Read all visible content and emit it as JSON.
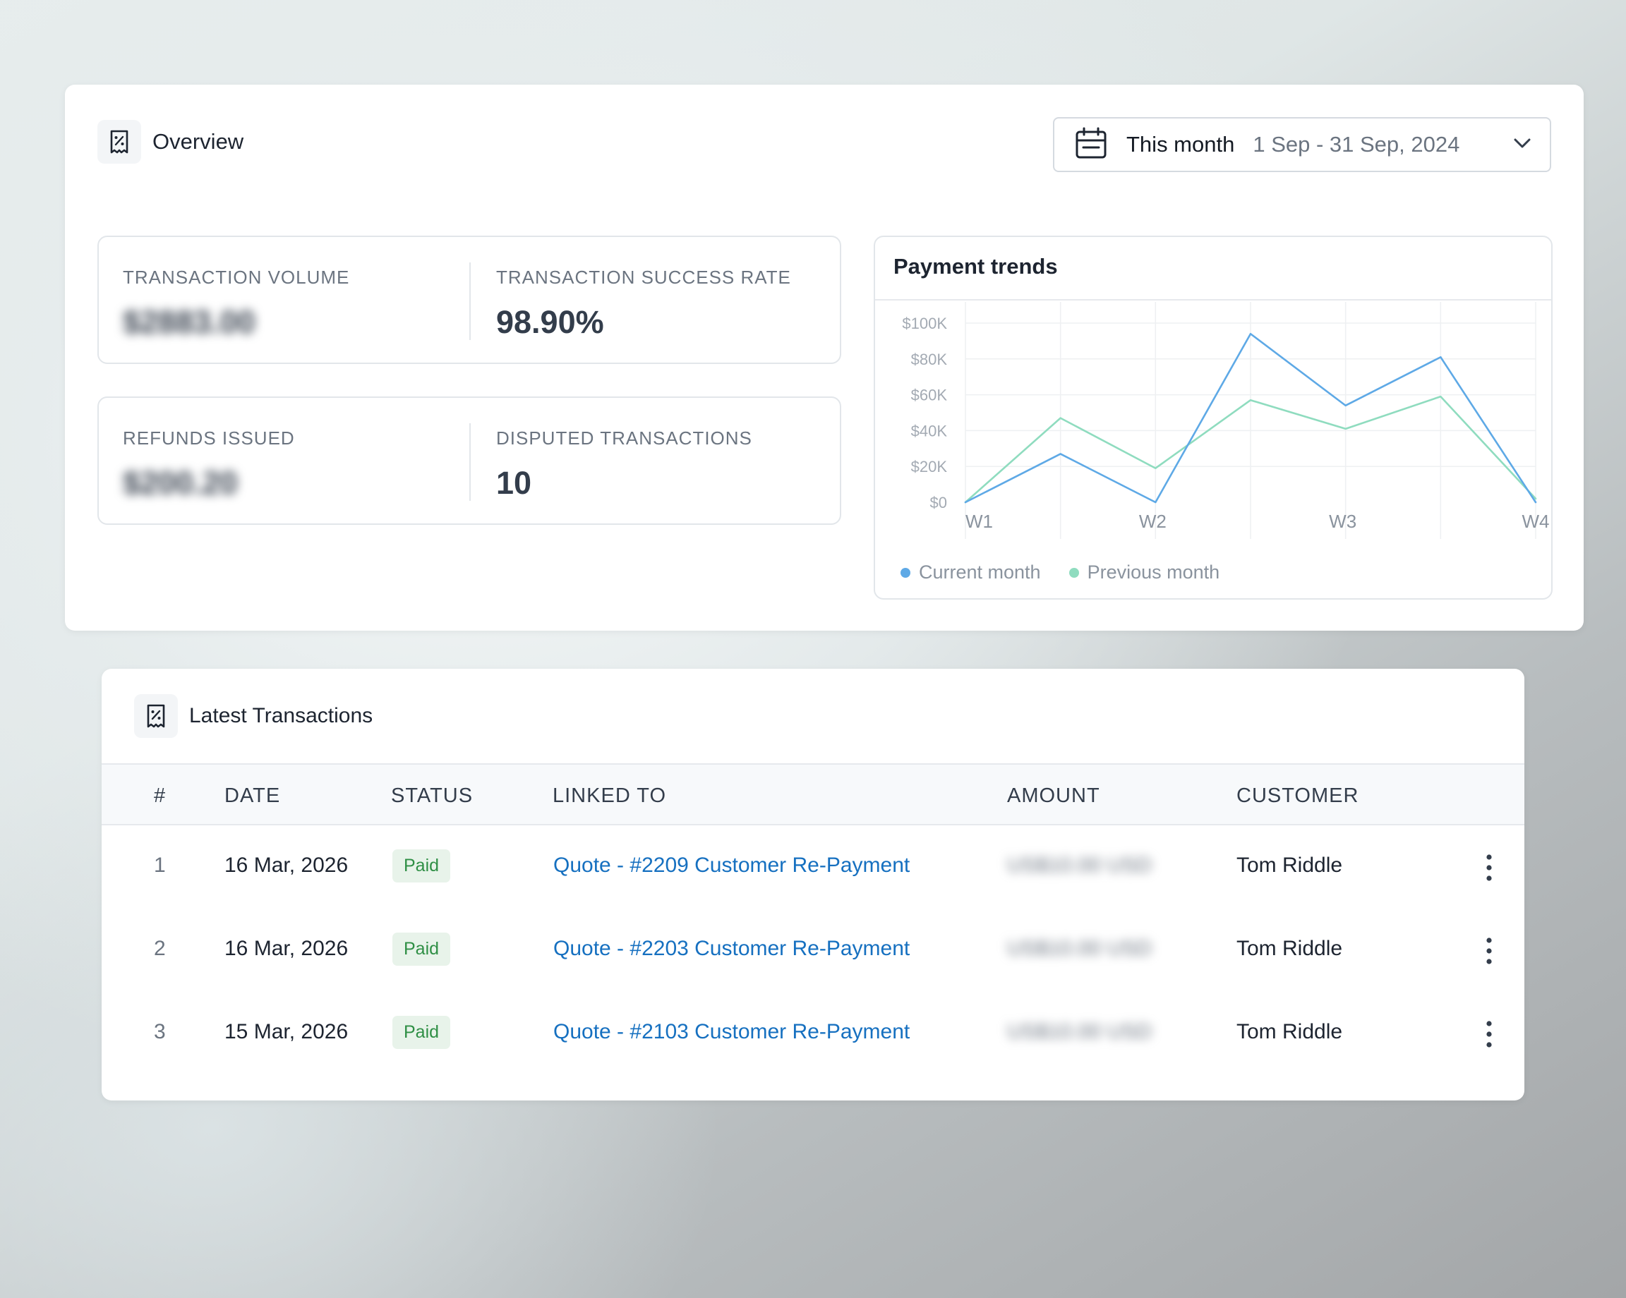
{
  "overview": {
    "title": "Overview",
    "icon": "receipt-percent-icon",
    "date_filter": {
      "label": "This month",
      "range": "1 Sep - 31 Sep, 2024",
      "icon": "calendar-icon",
      "chevron": "chevron-down-icon"
    },
    "stats": [
      {
        "label": "TRANSACTION VOLUME",
        "value": "$2883.00",
        "blurred": true
      },
      {
        "label": "TRANSACTION SUCCESS RATE",
        "value": "98.90%"
      },
      {
        "label": "REFUNDS ISSUED",
        "value": "$200.20",
        "blurred": true
      },
      {
        "label": "DISPUTED TRANSACTIONS",
        "value": "10"
      }
    ]
  },
  "chart_data": {
    "type": "line",
    "title": "Payment trends",
    "x": [
      "W1",
      "",
      "W2",
      "",
      "W3",
      "",
      "W4"
    ],
    "x_ticks": [
      "W1",
      "W2",
      "W3",
      "W4"
    ],
    "y_ticks": [
      "$100K",
      "$80K",
      "$60K",
      "$40K",
      "$20K",
      "$0"
    ],
    "ylim": [
      0,
      100000
    ],
    "grid": true,
    "legend_position": "bottom-left",
    "series": [
      {
        "name": "Current month",
        "color": "#5ea9e6",
        "values": [
          0,
          27000,
          0,
          94000,
          54000,
          81000,
          0
        ]
      },
      {
        "name": "Previous month",
        "color": "#8fdcbf",
        "values": [
          0,
          47000,
          19000,
          57000,
          41000,
          59000,
          2000
        ]
      }
    ]
  },
  "transactions": {
    "title": "Latest Transactions",
    "icon": "receipt-percent-icon",
    "columns": [
      "#",
      "DATE",
      "STATUS",
      "LINKED TO",
      "AMOUNT",
      "CUSTOMER"
    ],
    "rows": [
      {
        "index": "1",
        "date": "16 Mar, 2026",
        "status": "Paid",
        "linked_to": "Quote - #2209 Customer Re-Payment",
        "amount": "US$10.00 USD",
        "customer": "Tom Riddle"
      },
      {
        "index": "2",
        "date": "16 Mar, 2026",
        "status": "Paid",
        "linked_to": "Quote - #2203 Customer Re-Payment",
        "amount": "US$10.00 USD",
        "customer": "Tom Riddle"
      },
      {
        "index": "3",
        "date": "15 Mar, 2026",
        "status": "Paid",
        "linked_to": "Quote - #2103 Customer Re-Payment",
        "amount": "US$10.00 USD",
        "customer": "Tom Riddle"
      }
    ],
    "row_menu_icon": "kebab-menu-icon"
  },
  "colors": {
    "link": "#1670c0",
    "paid_badge_bg": "#e8f3ea",
    "paid_badge_text": "#2f8f45"
  }
}
